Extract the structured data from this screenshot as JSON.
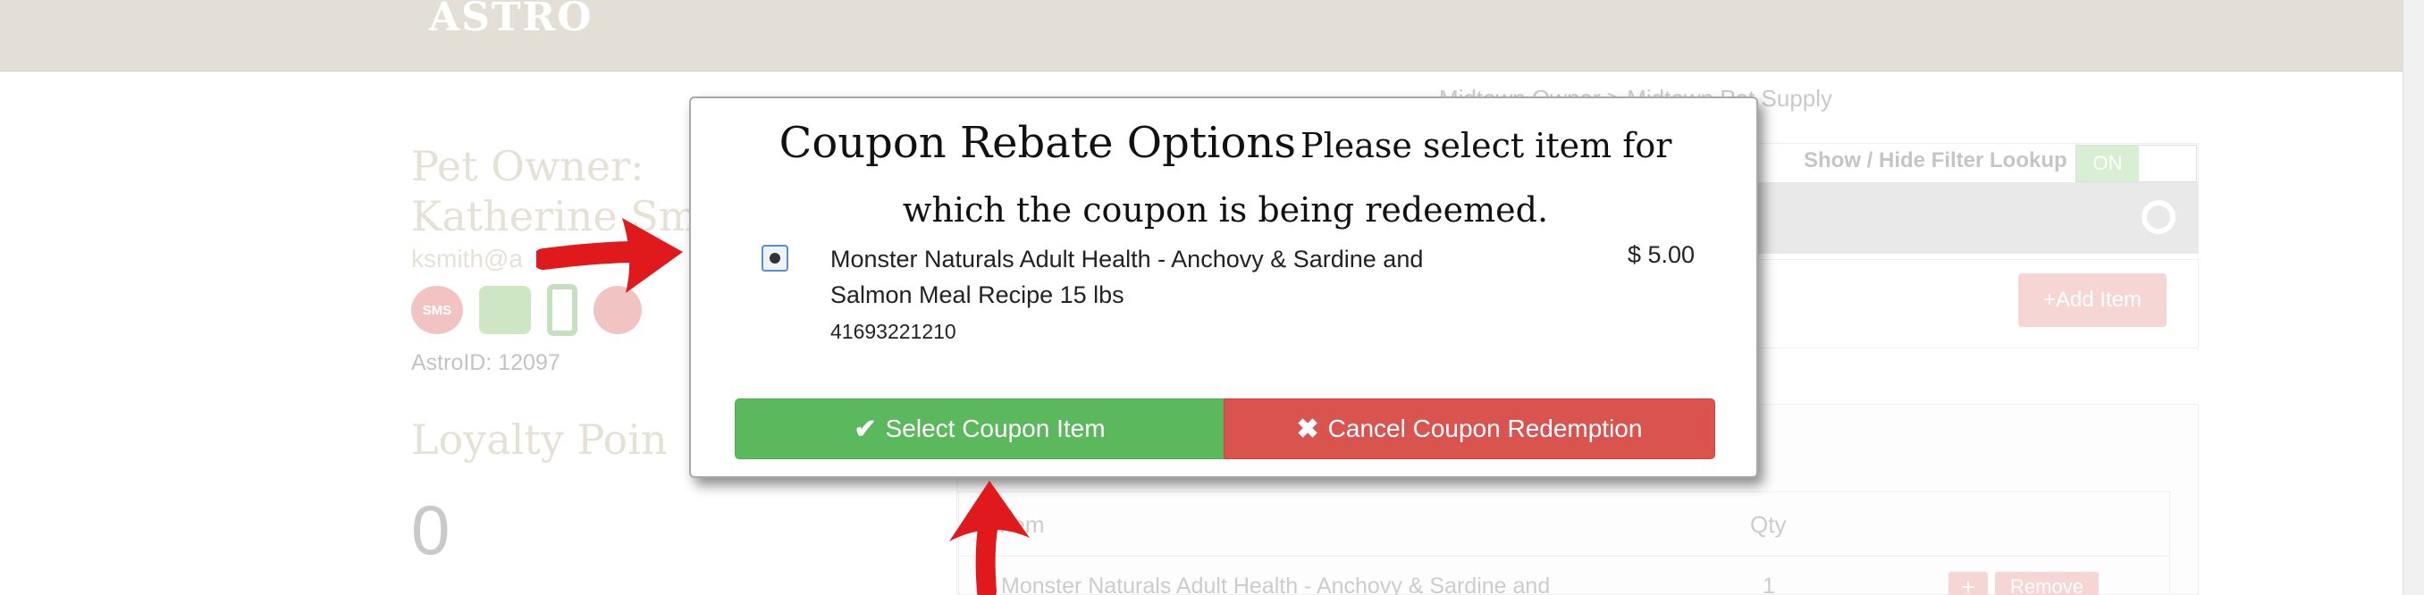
{
  "app": {
    "logo": "ASTRO"
  },
  "breadcrumb": "Midtown Owner > Midtown Pet Supply",
  "owner": {
    "title_line1": "Pet Owner:",
    "title_line2": "Katherine Sm",
    "email": "ksmith@a",
    "astro_id": "AstroID: 12097",
    "icons": [
      "sms-icon",
      "mail-icon",
      "phone-icon",
      "paw-icon"
    ],
    "sms_label": "SMS"
  },
  "loyalty": {
    "title": "Loyalty Poin",
    "value": "0"
  },
  "filter": {
    "label": "Show / Hide Filter Lookup",
    "toggle": "ON"
  },
  "actions": {
    "add_item": "Add Item",
    "plus": "+",
    "remove": "Remove"
  },
  "table": {
    "headers": [
      "Item",
      "Qty"
    ],
    "rows": [
      {
        "name": "Monster Naturals Adult Health - Anchovy & Sardine and",
        "qty": "1"
      }
    ]
  },
  "modal": {
    "title": "Coupon Rebate Options",
    "subtitle": "Please select item for which the coupon is being redeemed.",
    "item": {
      "name": "Monster Naturals Adult Health - Anchovy & Sardine and Salmon Meal Recipe 15 lbs",
      "upc": "41693221210",
      "price": "$ 5.00",
      "selected": true
    },
    "select_button": "Select Coupon Item",
    "cancel_button": "Cancel Coupon Redemption"
  },
  "colors": {
    "topbar": "#e4dfd6",
    "success": "#5cb85c",
    "danger": "#d9534f",
    "annotation_arrow": "#e0191c"
  }
}
